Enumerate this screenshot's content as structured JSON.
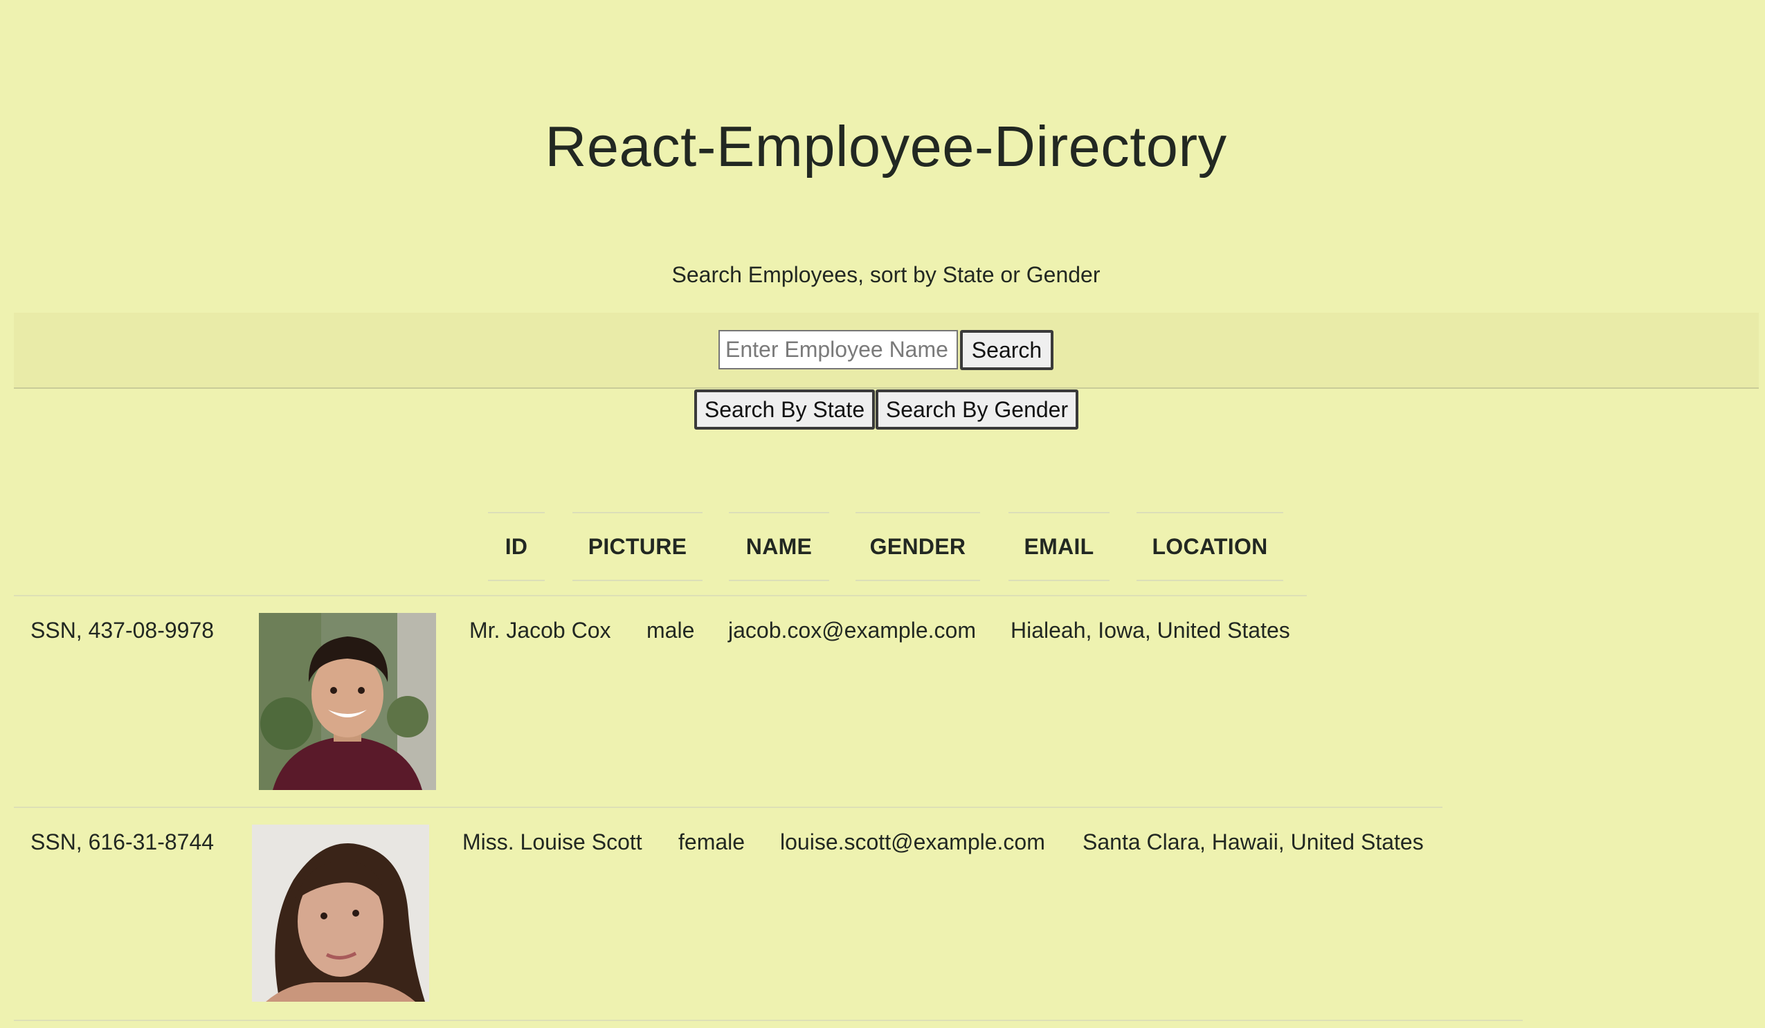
{
  "header": {
    "title": "React-Employee-Directory",
    "subtitle": "Search Employees, sort by State or Gender"
  },
  "search": {
    "placeholder": "Enter Employee Name",
    "value": "",
    "button_label": "Search"
  },
  "sort_buttons": {
    "state_label": "Search By State",
    "gender_label": "Search By Gender"
  },
  "table": {
    "columns": [
      "ID",
      "PICTURE",
      "NAME",
      "GENDER",
      "EMAIL",
      "LOCATION"
    ],
    "rows": [
      {
        "id": "SSN, 437-08-9978",
        "picture": "male-portrait",
        "name": "Mr. Jacob Cox",
        "gender": "male",
        "email": "jacob.cox@example.com",
        "location": "Hialeah, Iowa, United States"
      },
      {
        "id": "SSN, 616-31-8744",
        "picture": "female-portrait",
        "name": "Miss. Louise Scott",
        "gender": "female",
        "email": "louise.scott@example.com",
        "location": "Santa Clara, Hawaii, United States"
      }
    ]
  },
  "colors": {
    "background": "#eef2b0",
    "search_band": "#e9eba8",
    "text": "#222822"
  }
}
